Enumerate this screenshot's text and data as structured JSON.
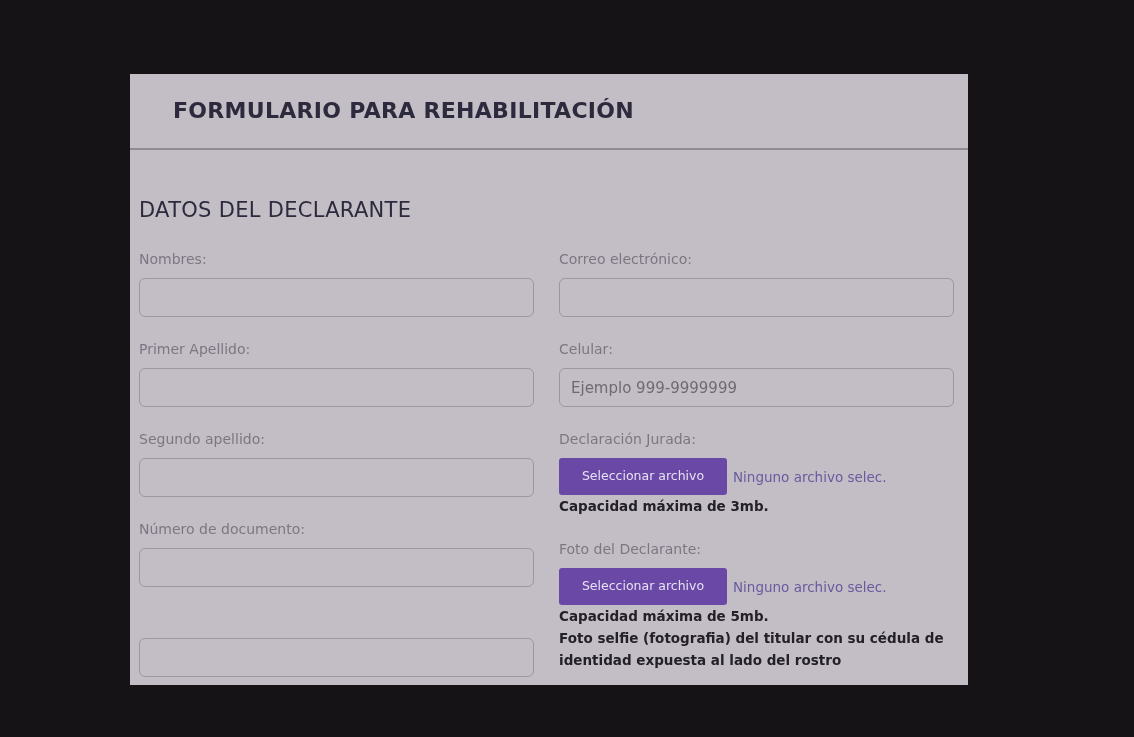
{
  "header": {
    "title": "FORMULARIO PARA REHABILITACIÓN"
  },
  "section_title": "DATOS DEL DECLARANTE",
  "left_fields": [
    {
      "kind": "text",
      "label": "Nombres:"
    },
    {
      "kind": "text",
      "label": "Primer Apellido:"
    },
    {
      "kind": "text",
      "label": "Segundo apellido:"
    },
    {
      "kind": "text",
      "label": "Número de documento:"
    },
    {
      "kind": "text"
    }
  ],
  "right_fields": [
    {
      "kind": "text",
      "label": "Correo electrónico:"
    },
    {
      "kind": "text",
      "label": "Celular:",
      "placeholder": "Ejemplo 999-9999999"
    },
    {
      "kind": "file",
      "label": "Declaración Jurada:",
      "button": "Seleccionar archivo",
      "status": "Ninguno archivo selec.",
      "notes": [
        "Capacidad máxima de 3mb."
      ]
    },
    {
      "kind": "file",
      "label": "Foto del Declarante:",
      "button": "Seleccionar archivo",
      "status": "Ninguno archivo selec.",
      "notes": [
        "Capacidad máxima de 5mb.",
        "Foto selfie (fotografia) del titular con su cédula de identidad expuesta al lado del rostro"
      ]
    }
  ]
}
